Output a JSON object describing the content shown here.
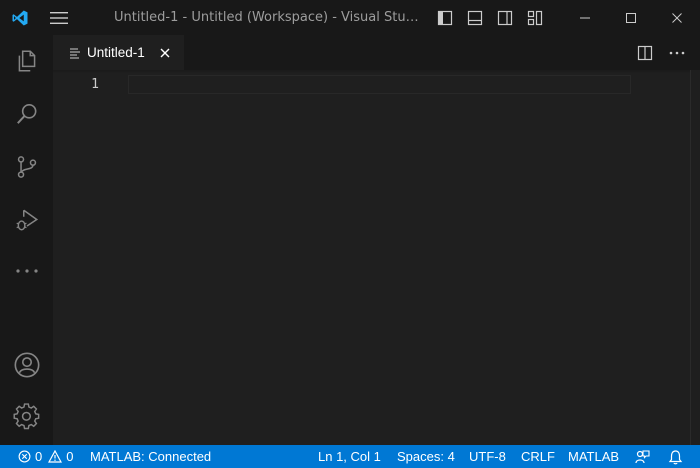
{
  "titlebar": {
    "title": "Untitled-1 - Untitled (Workspace) - Visual Studio C..."
  },
  "tab": {
    "label": "Untitled-1"
  },
  "editor": {
    "line_number": "1"
  },
  "statusbar": {
    "errors": "0",
    "warnings": "0",
    "matlab_status": "MATLAB: Connected",
    "cursor_position": "Ln 1, Col 1",
    "indentation": "Spaces: 4",
    "encoding": "UTF-8",
    "line_ending": "CRLF",
    "language": "MATLAB"
  },
  "colors": {
    "accent": "#0078d4",
    "logo": "#23a9f2",
    "background": "#1f1f1f",
    "chrome": "#181818"
  },
  "icons": [
    "vscode-logo-icon",
    "menu-icon",
    "toggle-primary-sidebar-icon",
    "toggle-panel-icon",
    "toggle-secondary-sidebar-icon",
    "customize-layout-icon",
    "minimize-icon",
    "maximize-icon",
    "close-icon",
    "explorer-icon",
    "search-icon",
    "source-control-icon",
    "run-debug-icon",
    "more-icon",
    "accounts-icon",
    "manage-gear-icon",
    "file-lines-icon",
    "tab-close-icon",
    "split-editor-icon",
    "more-actions-icon",
    "error-icon",
    "warning-icon",
    "feedback-icon",
    "notifications-bell-icon"
  ]
}
